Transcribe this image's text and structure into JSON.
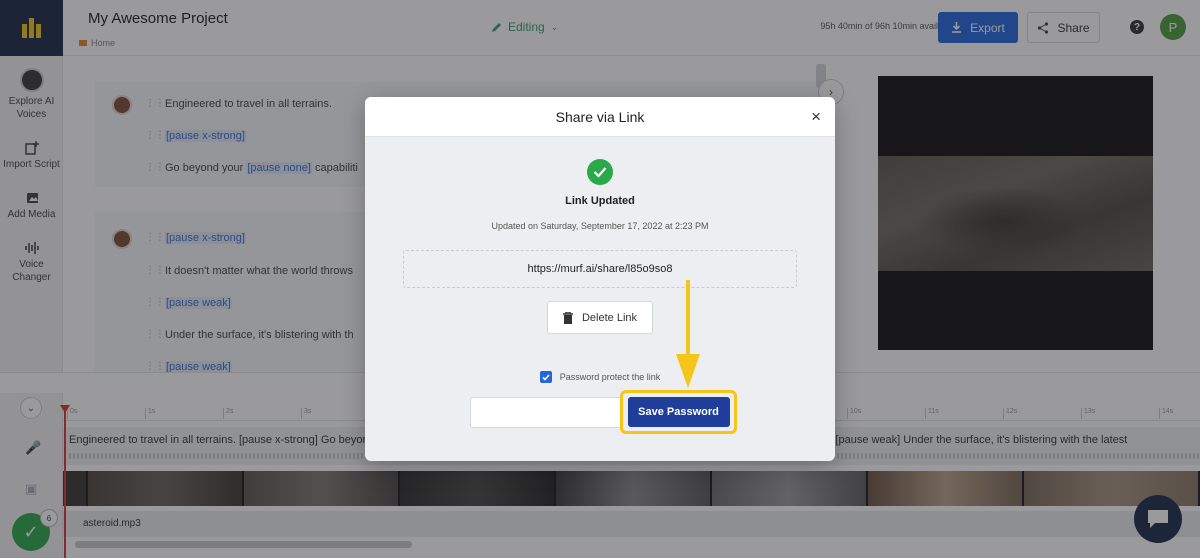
{
  "sidebar": {
    "items": [
      {
        "label": "Explore AI Voices"
      },
      {
        "label": "Import Script"
      },
      {
        "label": "Add Media"
      },
      {
        "label": "Voice Changer"
      }
    ]
  },
  "header": {
    "project_title": "My Awesome Project",
    "breadcrumb": "Home",
    "mode": "Editing",
    "availability": "95h 40min of 96h 10min available",
    "export_label": "Export",
    "share_label": "Share",
    "user_initial": "P"
  },
  "script": {
    "block1": {
      "line1": "Engineered to travel in all terrains.",
      "line2": "[pause x-strong]",
      "line3_pre": "Go beyond your ",
      "line3_tag": "[pause none]",
      "line3_post": " capabiliti"
    },
    "block2": {
      "line1": "[pause x-strong]",
      "line2": "It doesn't matter what the world throws",
      "line3": "[pause weak]",
      "line4": "Under the surface, it's blistering with th",
      "line5": "[pause weak]"
    }
  },
  "timeline": {
    "ruler_ticks": [
      "0s",
      "1s",
      "2s",
      "3s",
      "4s",
      "5s",
      "6s",
      "7s",
      "8s",
      "9s",
      "10s",
      "11s",
      "12s",
      "13s",
      "14s"
    ],
    "voice_track_text": "Engineered to travel in all terrains. [pause x-strong] Go beyond your [pause none] capabilities. [pause x-strong] It doesn't matter what the world throws at you [pause weak] Under the surface, it's blistering with the latest",
    "music_track_label": "asteroid.mp3"
  },
  "notifications": {
    "count": "6"
  },
  "modal": {
    "title": "Share via Link",
    "status_title": "Link Updated",
    "status_date": "Updated on Saturday, September 17, 2022 at 2:23 PM",
    "share_url": "https://murf.ai/share/l85o9so8",
    "delete_label": "Delete Link",
    "password_protect_label": "Password protect the link",
    "password_protect_checked": true,
    "password_value": "",
    "save_password_label": "Save Password"
  },
  "colors": {
    "primary": "#2466dc",
    "save_button": "#1e3e99",
    "highlight": "#f5c518",
    "success": "#2aa84a",
    "editing": "#3a9b6a"
  }
}
